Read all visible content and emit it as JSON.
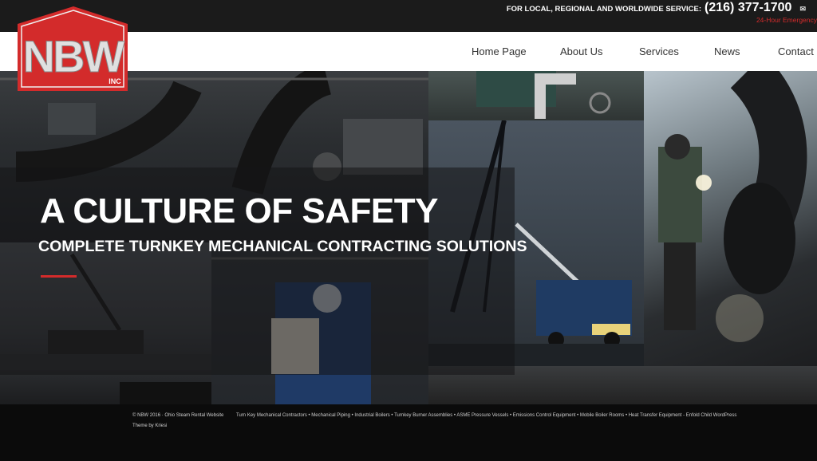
{
  "topbar": {
    "service_text": "FOR LOCAL, REGIONAL AND WORLDWIDE SERVICE:",
    "phone": "(216) 377-1700",
    "mail_icon": "envelope-icon",
    "emergency": "24-Hour Emergency"
  },
  "logo": {
    "text": "NBW",
    "sub": "INC",
    "colors": {
      "red": "#d32b2b",
      "silver": "#d9d9d9"
    }
  },
  "nav": {
    "items": [
      {
        "label": "Home Page"
      },
      {
        "label": "About Us"
      },
      {
        "label": "Services"
      },
      {
        "label": "News"
      },
      {
        "label": "Contact U"
      }
    ]
  },
  "hero": {
    "title": "A CULTURE OF SAFETY",
    "subtitle": "COMPLETE TURNKEY MECHANICAL CONTRACTING SOLUTIONS",
    "accent": "#d32b2b"
  },
  "footer": {
    "copyright": "© NBW 2016 · Ohio Steam Rental Website",
    "links": "Turn Key Mechanical Contractors • Mechanical Piping • Industrial Boilers • Turnkey Burner Assemblies • ASME Pressure Vessels • Emissions Control Equipment • Mobile Boiler Rooms • Heat Transfer Equipment - Enfold Child WordPress",
    "theme": "Theme by Kriesi"
  }
}
